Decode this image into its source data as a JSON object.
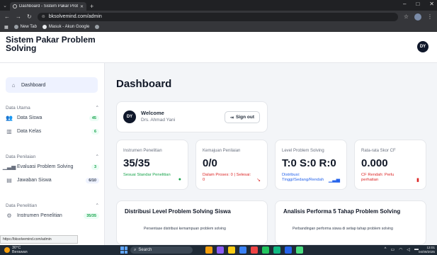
{
  "browser": {
    "tab_title": "Dashboard - Sistem Pakar Probl...",
    "url": "bksolvemind.com/admin",
    "bookmarks": [
      "New Tab",
      "Masuk - Akun Google"
    ]
  },
  "app": {
    "brand": "Sistem Pakar Problem Solving",
    "user_initials": "DY"
  },
  "sidebar": {
    "dashboard_label": "Dashboard",
    "groups": [
      {
        "title": "Data Utama",
        "items": [
          {
            "label": "Data Siswa",
            "badge": "45"
          },
          {
            "label": "Data Kelas",
            "badge": "6"
          }
        ]
      },
      {
        "title": "Data Penilaian",
        "items": [
          {
            "label": "Evaluasi Problem Solving",
            "badge": "3"
          },
          {
            "label": "Jawaban Siswa",
            "badge": "6/10"
          }
        ]
      },
      {
        "title": "Data Penelitian",
        "items": [
          {
            "label": "Instrumen Penelitian",
            "badge": "35/35"
          }
        ]
      }
    ]
  },
  "main": {
    "title": "Dashboard",
    "welcome": {
      "heading": "Welcome",
      "name": "Drs. Ahmad Yani",
      "signout_label": "Sign out"
    },
    "stats": [
      {
        "label": "Instrumen Penelitian",
        "value": "35/35",
        "desc": "Sesuai Standar Penelitian",
        "color": "#16a34a",
        "icon": "check-circle-icon"
      },
      {
        "label": "Kemajuan Penilaian",
        "value": "0/0",
        "desc": "Dalam Proses: 0 | Selesai: 0",
        "color": "#dc2626",
        "icon": "trend-icon"
      },
      {
        "label": "Level Problem Solving",
        "value": "T:0 S:0 R:0",
        "desc": "Distribusi: Tinggi/Sedang/Rendah",
        "color": "#2563eb",
        "icon": "bar-chart-icon"
      },
      {
        "label": "Rata-rata Skor CF",
        "value": "0.000",
        "desc": "CF Rendah: Perlu perhatian",
        "color": "#dc2626",
        "icon": "trash-icon"
      }
    ],
    "panels": [
      {
        "title": "Distribusi Level Problem Solving Siswa",
        "subtitle": "Persentase distribusi kemampuan problem solving"
      },
      {
        "title": "Analisis Performa 5 Tahap Problem Solving",
        "subtitle": "Perbandingan performa siswa di setiap tahap problem solving"
      }
    ]
  },
  "status_url": "https://bksolvemind.com/admin",
  "taskbar": {
    "temp": "30°C",
    "weather": "Berawan",
    "search": "Search",
    "time": "13:01",
    "date": "04/09/2025"
  }
}
